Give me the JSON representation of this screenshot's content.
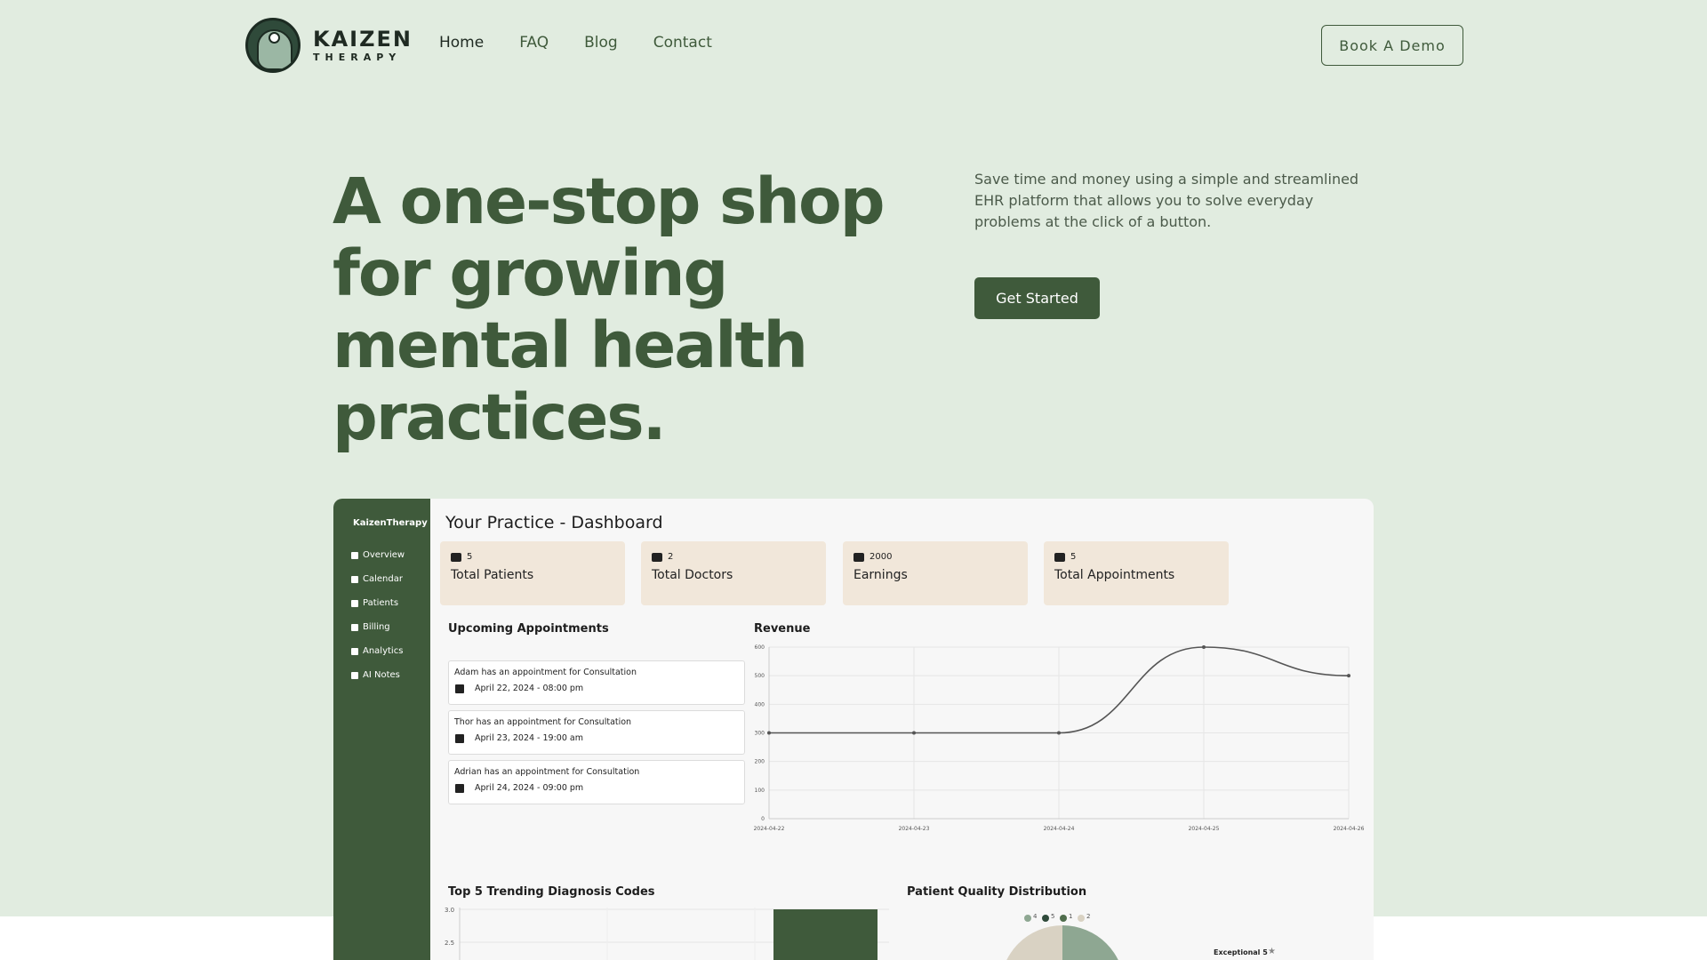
{
  "brand": {
    "name": "KAIZEN",
    "subtitle": "THERAPY"
  },
  "nav": {
    "items": [
      "Home",
      "FAQ",
      "Blog",
      "Contact"
    ],
    "active": "Home"
  },
  "header": {
    "demo_label": "Book A Demo"
  },
  "hero": {
    "headline": "A one-stop shop for growing mental health practices.",
    "subtext": "Save time and money using a simple and streamlined EHR platform that allows you to solve everyday problems at the click of a button.",
    "cta_label": "Get Started"
  },
  "dashboard": {
    "sidebar_brand": "KaizenTherapy",
    "sidebar_items": [
      {
        "label": "Overview",
        "icon": "home-icon"
      },
      {
        "label": "Calendar",
        "icon": "calendar-icon"
      },
      {
        "label": "Patients",
        "icon": "patients-icon"
      },
      {
        "label": "Billing",
        "icon": "billing-icon"
      },
      {
        "label": "Analytics",
        "icon": "analytics-icon"
      },
      {
        "label": "AI Notes",
        "icon": "ai-notes-icon"
      }
    ],
    "title": "Your Practice - Dashboard",
    "stats": [
      {
        "value": "5",
        "label": "Total Patients",
        "icon": "users-icon"
      },
      {
        "value": "2",
        "label": "Total Doctors",
        "icon": "doctor-icon"
      },
      {
        "value": "2000",
        "label": "Earnings",
        "icon": "earnings-icon"
      },
      {
        "value": "5",
        "label": "Total Appointments",
        "icon": "calendar-icon"
      }
    ],
    "appointments_title": "Upcoming Appointments",
    "appointments": [
      {
        "text": "Adam has an appointment for Consultation",
        "date": "April 22, 2024 - 08:00 pm"
      },
      {
        "text": "Thor has an appointment for Consultation",
        "date": "April 23, 2024 - 19:00 am"
      },
      {
        "text": "Adrian has an appointment for Consultation",
        "date": "April 24, 2024 - 09:00 pm"
      }
    ],
    "diagnosis_title": "Top 5 Trending Diagnosis Codes",
    "diagnosis_ticks": [
      "3.0",
      "2.5"
    ],
    "quality_title": "Patient Quality Distribution",
    "quality_legend": [
      "4",
      "5",
      "1",
      "2"
    ],
    "quality_label": "Exceptional 5"
  },
  "chart_data": {
    "type": "line",
    "title": "Revenue",
    "x": [
      "2024-04-22",
      "2024-04-23",
      "2024-04-24",
      "2024-04-25",
      "2024-04-26"
    ],
    "series": [
      {
        "values": [
          300,
          300,
          300,
          600,
          500
        ]
      }
    ],
    "ylim": [
      0,
      600
    ],
    "yticks": [
      "600",
      "500",
      "400",
      "300",
      "200",
      "100",
      "0"
    ],
    "grid": true,
    "color": "#555555"
  }
}
